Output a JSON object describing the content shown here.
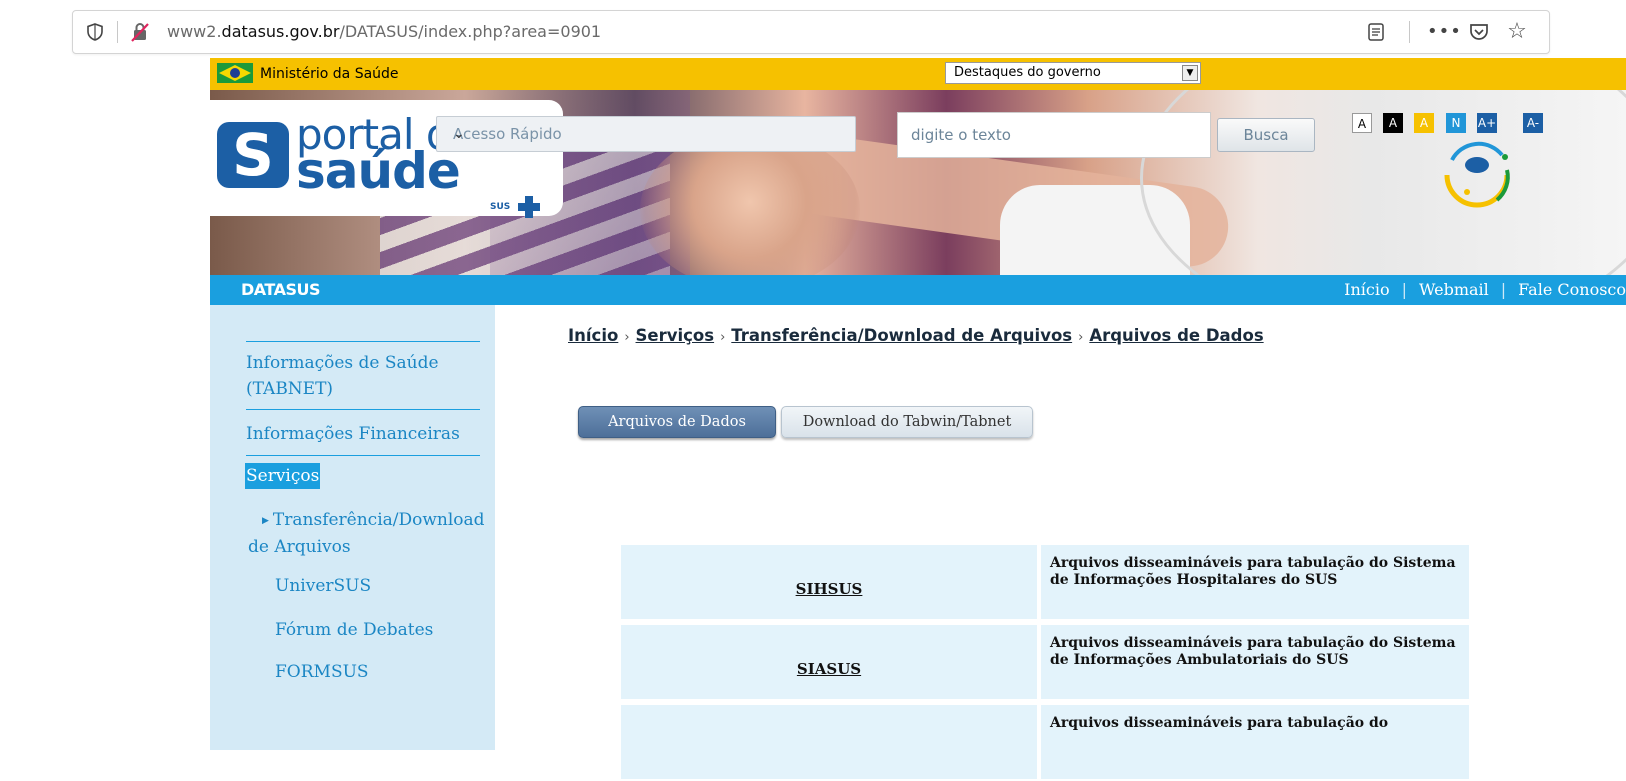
{
  "browser": {
    "url_prefix": "www2.",
    "url_domain": "datasus.gov.br",
    "url_path": "/DATASUS/index.php?area=0901"
  },
  "govbar": {
    "ministry": "Ministério da Saúde",
    "select_value": "Destaques do governo"
  },
  "header": {
    "logo_portal": "portal da",
    "logo_saude": "saúde",
    "logo_sus": "SUS",
    "quick_access": "Acesso Rápido",
    "search_placeholder": "digite o texto",
    "search_button": "Busca",
    "accessibility": [
      "A",
      "A",
      "A",
      "N",
      "A+",
      "A-"
    ]
  },
  "nav": {
    "brand": "DATASUS",
    "links": [
      "Início",
      "Webmail",
      "Fale Conosco"
    ]
  },
  "sidebar": {
    "items": [
      {
        "label_line1": "Informações de Saúde",
        "label_line2": "(TABNET)"
      },
      {
        "label": "Informações Financeiras"
      },
      {
        "label": "Serviços"
      }
    ],
    "sub_items": [
      {
        "label_line1": "Transferência/Download",
        "label_line2": "de Arquivos"
      },
      {
        "label": "UniverSUS"
      },
      {
        "label": "Fórum de Debates"
      },
      {
        "label": "FORMSUS"
      }
    ]
  },
  "breadcrumb": [
    "Início",
    "Serviços",
    "Transferência/Download de Arquivos",
    "Arquivos de Dados"
  ],
  "tabs": [
    "Arquivos de Dados",
    "Download do Tabwin/Tabnet"
  ],
  "rows": [
    {
      "name": "SIHSUS",
      "desc": "Arquivos disseamináveis"
    },
    {
      "name": "SIASUS",
      "desc": ""
    },
    {
      "name": "",
      "desc": ""
    }
  ],
  "rows_text": {
    "r1_name": "SIHSUS",
    "r1_desc": "Arquivos disseamináveis para tabulação do Sistema de Informações Hospitalares do SUS",
    "r2_name": "SIASUS",
    "r2_desc": "Arquivos disseamináveis para tabulação do Sistema de Informações Ambulatoriais do SUS",
    "r3_desc": "Arquivos disseamináveis para tabulação do"
  },
  "colors": {
    "gov_yellow": "#f6c100",
    "nav_blue": "#1a9fdf",
    "sidebar_bg": "#d4eaf6",
    "table_bg": "#e3f3fb",
    "tab_active": "#4d6f99"
  }
}
